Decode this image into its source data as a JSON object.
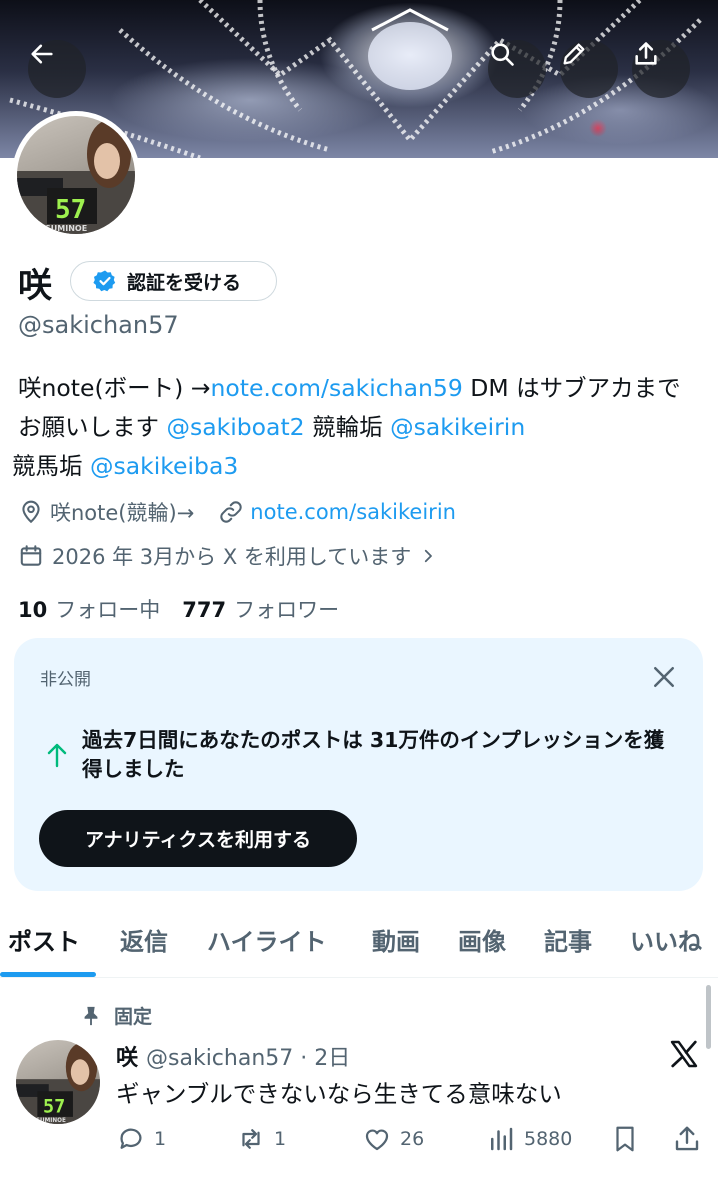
{
  "header": {
    "back_icon": "arrow-left-icon",
    "search_icon": "search-icon",
    "edit_icon": "pencil-icon",
    "share_icon": "share-icon"
  },
  "avatar": {
    "counter_text": "57",
    "brand_text": "SUMINOE"
  },
  "profile": {
    "name": "咲",
    "verify_label": "認証を受ける",
    "handle": "@sakichan57",
    "bio": {
      "t1": "咲note(ボート) →",
      "link1": "note.com/sakichan59",
      "t2": " DM はサブアカまでお願いします ",
      "link2": "@sakiboat2",
      "t3": " 競輪垢 ",
      "link3": "@sakikeirin",
      "t4": " 競馬垢 ",
      "link4": "@sakikeiba3"
    },
    "location": "咲note(競輪)→",
    "website": "note.com/sakikeirin",
    "joined": "2026 年 3月から X を利用しています",
    "following_count": "10",
    "following_label": "フォロー中",
    "followers_count": "777",
    "followers_label": "フォロワー"
  },
  "private_card": {
    "tag": "非公開",
    "message": "過去7日間にあなたのポストは 31万件のインプレッションを獲得しました",
    "button": "アナリティクスを利用する"
  },
  "tabs": [
    "ポスト",
    "返信",
    "ハイライト",
    "動画",
    "画像",
    "記事",
    "いいね"
  ],
  "post": {
    "pinned_label": "固定",
    "name": "咲",
    "handle_time": "@sakichan57 · 2日",
    "text": "ギャンブルできないなら生きてる意味ない",
    "replies": "1",
    "reposts": "1",
    "likes": "26",
    "views": "5880"
  },
  "colors": {
    "accent": "#1d9bf0",
    "text": "#0f1419",
    "muted": "#536471",
    "card_bg": "#eaf6ff",
    "up_arrow": "#00ba7c"
  }
}
